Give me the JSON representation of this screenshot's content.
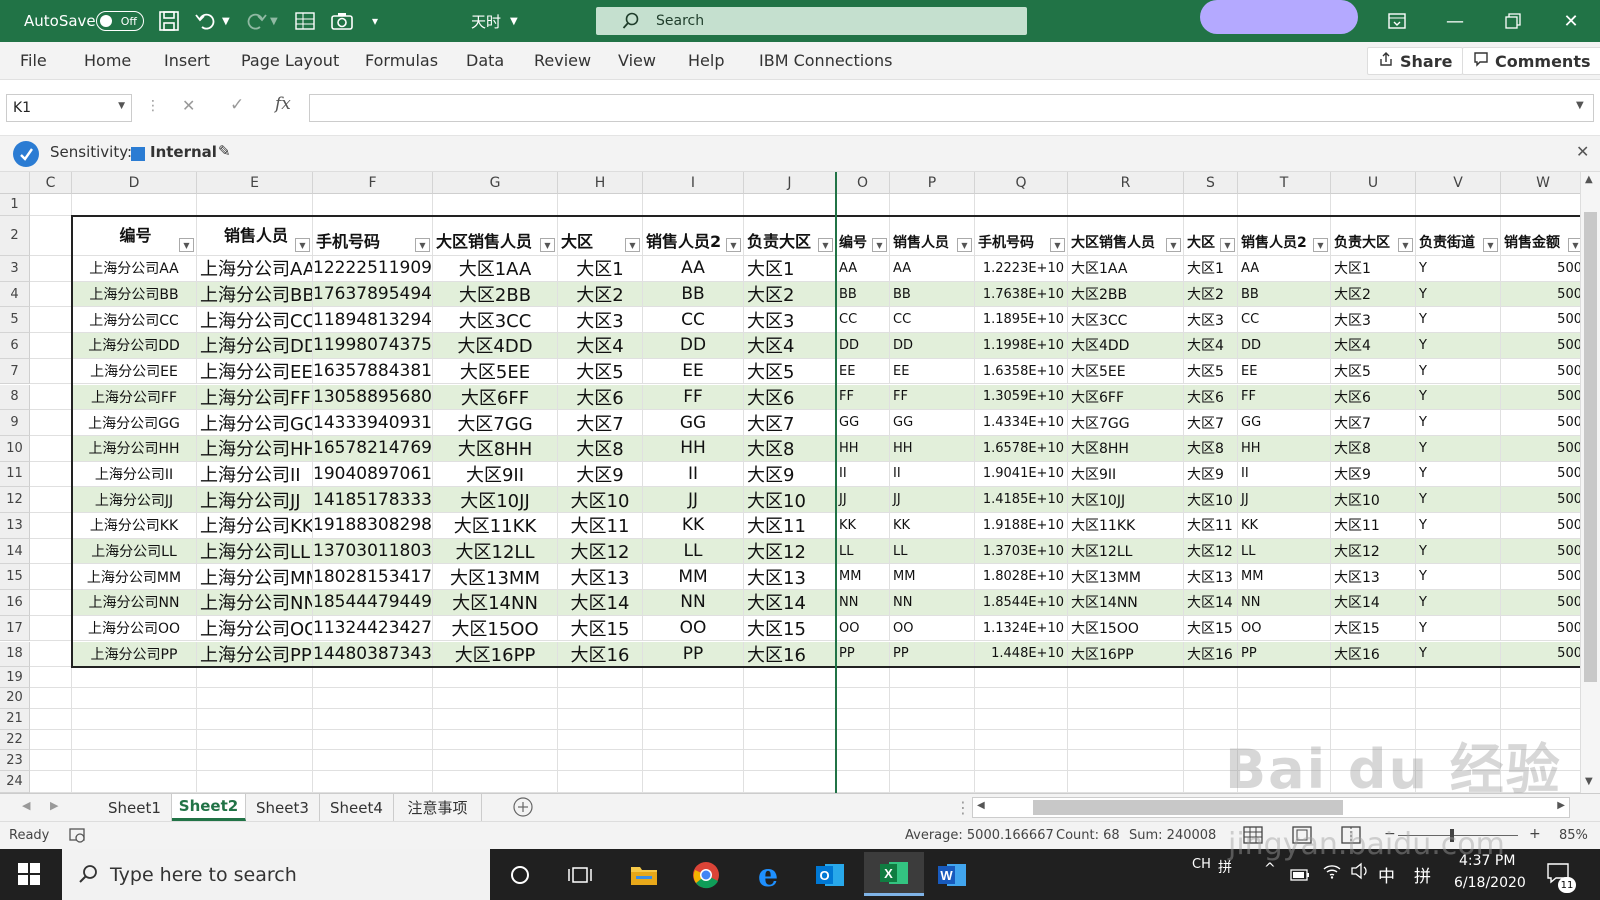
{
  "titlebar": {
    "autosave_label": "AutoSave",
    "autosave_state": "Off",
    "quick_font": "天时",
    "search_placeholder": "Search"
  },
  "menu": {
    "items": [
      "File",
      "Home",
      "Insert",
      "Page Layout",
      "Formulas",
      "Data",
      "Review",
      "View",
      "Help",
      "IBM Connections"
    ],
    "share": "Share",
    "comments": "Comments"
  },
  "formula_bar": {
    "name_box": "K1",
    "fx_label": "fx",
    "formula": ""
  },
  "sensitivity": {
    "label": "Sensitivity:",
    "value": "Internal"
  },
  "columns": [
    "C",
    "D",
    "E",
    "F",
    "G",
    "H",
    "I",
    "J",
    "O",
    "P",
    "Q",
    "R",
    "S",
    "T",
    "U",
    "V",
    "W"
  ],
  "rows": [
    "1",
    "2",
    "3",
    "4",
    "5",
    "6",
    "7",
    "8",
    "9",
    "10",
    "11",
    "12",
    "13",
    "14",
    "15",
    "16",
    "17",
    "18",
    "19",
    "20",
    "21",
    "22",
    "23",
    "24"
  ],
  "table_left": {
    "headers": [
      "编号",
      "销售人员",
      "手机号码",
      "大区销售人员",
      "大区",
      "销售人员2",
      "负责大区"
    ],
    "rows": [
      [
        "上海分公司AA",
        "上海分公司AA",
        "12222511909",
        "大区1AA",
        "大区1",
        "AA",
        "大区1"
      ],
      [
        "上海分公司BB",
        "上海分公司BB",
        "17637895494",
        "大区2BB",
        "大区2",
        "BB",
        "大区2"
      ],
      [
        "上海分公司CC",
        "上海分公司CC",
        "11894813294",
        "大区3CC",
        "大区3",
        "CC",
        "大区3"
      ],
      [
        "上海分公司DD",
        "上海分公司DD",
        "11998074375",
        "大区4DD",
        "大区4",
        "DD",
        "大区4"
      ],
      [
        "上海分公司EE",
        "上海分公司EE",
        "16357884381",
        "大区5EE",
        "大区5",
        "EE",
        "大区5"
      ],
      [
        "上海分公司FF",
        "上海分公司FF",
        "13058895680",
        "大区6FF",
        "大区6",
        "FF",
        "大区6"
      ],
      [
        "上海分公司GG",
        "上海分公司GG",
        "14333940931",
        "大区7GG",
        "大区7",
        "GG",
        "大区7"
      ],
      [
        "上海分公司HH",
        "上海分公司HH",
        "16578214769",
        "大区8HH",
        "大区8",
        "HH",
        "大区8"
      ],
      [
        "上海分公司II",
        "上海分公司II",
        "19040897061",
        "大区9II",
        "大区9",
        "II",
        "大区9"
      ],
      [
        "上海分公司JJ",
        "上海分公司JJ",
        "14185178333",
        "大区10JJ",
        "大区10",
        "JJ",
        "大区10"
      ],
      [
        "上海分公司KK",
        "上海分公司KK",
        "19188308298",
        "大区11KK",
        "大区11",
        "KK",
        "大区11"
      ],
      [
        "上海分公司LL",
        "上海分公司LL",
        "13703011803",
        "大区12LL",
        "大区12",
        "LL",
        "大区12"
      ],
      [
        "上海分公司MM",
        "上海分公司MM",
        "18028153417",
        "大区13MM",
        "大区13",
        "MM",
        "大区13"
      ],
      [
        "上海分公司NN",
        "上海分公司NN",
        "18544479449",
        "大区14NN",
        "大区14",
        "NN",
        "大区14"
      ],
      [
        "上海分公司OO",
        "上海分公司OO",
        "11324423427",
        "大区15OO",
        "大区15",
        "OO",
        "大区15"
      ],
      [
        "上海分公司PP",
        "上海分公司PP",
        "14480387343",
        "大区16PP",
        "大区16",
        "PP",
        "大区16"
      ]
    ]
  },
  "table_right": {
    "headers": [
      "编号",
      "销售人员",
      "手机号码",
      "大区销售人员",
      "大区",
      "销售人员2",
      "负责大区",
      "负责街道",
      "销售金额"
    ],
    "rows": [
      [
        "AA",
        "AA",
        "1.2223E+10",
        "大区1AA",
        "大区1",
        "AA",
        "大区1",
        "Y",
        "500"
      ],
      [
        "BB",
        "BB",
        "1.7638E+10",
        "大区2BB",
        "大区2",
        "BB",
        "大区2",
        "Y",
        "500"
      ],
      [
        "CC",
        "CC",
        "1.1895E+10",
        "大区3CC",
        "大区3",
        "CC",
        "大区3",
        "Y",
        "500"
      ],
      [
        "DD",
        "DD",
        "1.1998E+10",
        "大区4DD",
        "大区4",
        "DD",
        "大区4",
        "Y",
        "500"
      ],
      [
        "EE",
        "EE",
        "1.6358E+10",
        "大区5EE",
        "大区5",
        "EE",
        "大区5",
        "Y",
        "500"
      ],
      [
        "FF",
        "FF",
        "1.3059E+10",
        "大区6FF",
        "大区6",
        "FF",
        "大区6",
        "Y",
        "500"
      ],
      [
        "GG",
        "GG",
        "1.4334E+10",
        "大区7GG",
        "大区7",
        "GG",
        "大区7",
        "Y",
        "500"
      ],
      [
        "HH",
        "HH",
        "1.6578E+10",
        "大区8HH",
        "大区8",
        "HH",
        "大区8",
        "Y",
        "500"
      ],
      [
        "II",
        "II",
        "1.9041E+10",
        "大区9II",
        "大区9",
        "II",
        "大区9",
        "Y",
        "500"
      ],
      [
        "JJ",
        "JJ",
        "1.4185E+10",
        "大区10JJ",
        "大区10",
        "JJ",
        "大区10",
        "Y",
        "500"
      ],
      [
        "KK",
        "KK",
        "1.9188E+10",
        "大区11KK",
        "大区11",
        "KK",
        "大区11",
        "Y",
        "500"
      ],
      [
        "LL",
        "LL",
        "1.3703E+10",
        "大区12LL",
        "大区12",
        "LL",
        "大区12",
        "Y",
        "500"
      ],
      [
        "MM",
        "MM",
        "1.8028E+10",
        "大区13MM",
        "大区13",
        "MM",
        "大区13",
        "Y",
        "500"
      ],
      [
        "NN",
        "NN",
        "1.8544E+10",
        "大区14NN",
        "大区14",
        "NN",
        "大区14",
        "Y",
        "500"
      ],
      [
        "OO",
        "OO",
        "1.1324E+10",
        "大区15OO",
        "大区15",
        "OO",
        "大区15",
        "Y",
        "500"
      ],
      [
        "PP",
        "PP",
        "1.448E+10",
        "大区16PP",
        "大区16",
        "PP",
        "大区16",
        "Y",
        "500"
      ]
    ]
  },
  "sheets": {
    "tabs": [
      "Sheet1",
      "Sheet2",
      "Sheet3",
      "Sheet4",
      "注意事项"
    ],
    "active": "Sheet2"
  },
  "status": {
    "ready": "Ready",
    "average": "Average: 5000.166667",
    "count": "Count: 68",
    "sum": "Sum: 240008",
    "zoom": "85%"
  },
  "taskbar": {
    "search_placeholder": "Type here to search",
    "lang": "CH",
    "ime1": "拼",
    "ime2": "中",
    "ime3": "拼",
    "time": "4:37 PM",
    "date": "6/18/2020",
    "notifications": "11"
  },
  "watermark": {
    "brand": "Bai du 经验",
    "url": "jingyan.baidu.com"
  },
  "colors": {
    "excel_green": "#217346",
    "band_green": "#e2efda",
    "selection_green": "#217346"
  }
}
